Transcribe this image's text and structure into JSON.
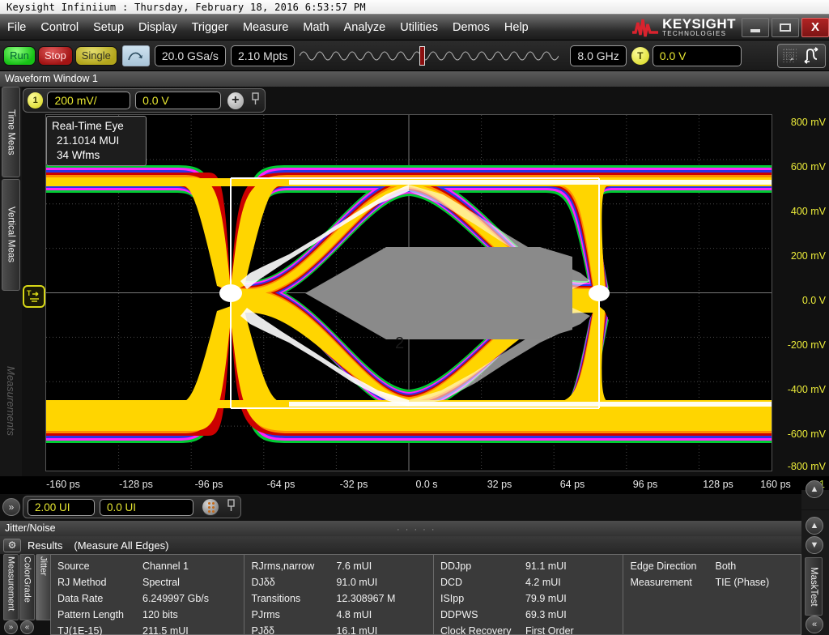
{
  "window": {
    "title": "Keysight Infiniium : Thursday, February 18, 2016 6:53:57 PM",
    "minimize_label": "minimize",
    "maximize_label": "maximize",
    "close_label": "X"
  },
  "brand": {
    "name": "KEYSIGHT",
    "subtitle": "TECHNOLOGIES"
  },
  "menu": {
    "items": [
      {
        "label": "File"
      },
      {
        "label": "Control"
      },
      {
        "label": "Setup"
      },
      {
        "label": "Display"
      },
      {
        "label": "Trigger"
      },
      {
        "label": "Measure"
      },
      {
        "label": "Math"
      },
      {
        "label": "Analyze"
      },
      {
        "label": "Utilities"
      },
      {
        "label": "Demos"
      },
      {
        "label": "Help"
      }
    ]
  },
  "toolbar": {
    "run_label": "Run",
    "stop_label": "Stop",
    "single_label": "Single",
    "autoscale_icon": "autoscale-icon",
    "sample_rate": "20.0 GSa/s",
    "memory_depth": "2.10 Mpts",
    "bandwidth": "8.0 GHz",
    "trigger_badge": "T",
    "trigger_level": "0.0 V",
    "nav_icon": "waveform-navigate-icon"
  },
  "waveform_window": {
    "title": "Waveform Window 1",
    "channel": {
      "number": "1",
      "scale": "200 mV/",
      "offset": "0.0 V",
      "add_label": "+",
      "pin_label": "pin-icon"
    }
  },
  "left_rail": {
    "tabs": [
      {
        "label": "Time Meas",
        "selected": true
      },
      {
        "label": "Vertical Meas",
        "selected": false
      },
      {
        "label": "Measurements",
        "selected": false,
        "dim": true
      }
    ]
  },
  "eye_legend": {
    "title": "Real-Time Eye",
    "mui": "21.1014 MUI",
    "waveforms": "34 Wfms"
  },
  "plot": {
    "trigger_icon": "trigger-level-icon",
    "mask_label": "2",
    "vertical_scale": "200 mV/",
    "y_ticks": [
      "800 mV",
      "600 mV",
      "400 mV",
      "200 mV",
      "0.0 V",
      "-200 mV",
      "-400 mV",
      "-600 mV",
      "-800 mV"
    ],
    "x_ticks": [
      "-160 ps",
      "-128 ps",
      "-96 ps",
      "-64 ps",
      "-32 ps",
      "0.0 s",
      "32 ps",
      "64 ps",
      "96 ps",
      "128 ps",
      "160 ps"
    ],
    "channel_marker": "1"
  },
  "ui_bar": {
    "expand_label": "»",
    "span": "2.00 UI",
    "position": "0.0 UI",
    "eye_icon": "eye-pattern-icon",
    "pin_label": "pin-icon"
  },
  "jitter_noise": {
    "title": "Jitter/Noise"
  },
  "results": {
    "gear_icon": "gear-icon",
    "title": "Results",
    "subtitle": "(Measure All Edges)",
    "tabs": [
      {
        "label": "Measurement"
      },
      {
        "label": "ColorGrade"
      },
      {
        "label": "Jitter",
        "selected": true
      }
    ],
    "columns": [
      {
        "rows": [
          {
            "key": "Source",
            "value": "Channel 1"
          },
          {
            "key": "RJ Method",
            "value": "Spectral"
          },
          {
            "key": "Data Rate",
            "value": "6.249997 Gb/s"
          },
          {
            "key": "Pattern Length",
            "value": "120 bits"
          },
          {
            "key": "TJ(1E-15)",
            "value": "211.5 mUI"
          }
        ]
      },
      {
        "rows": [
          {
            "key": "RJrms,narrow",
            "value": "7.6 mUI"
          },
          {
            "key": "DJδδ",
            "value": "91.0 mUI"
          },
          {
            "key": "Transitions",
            "value": "12.308967 M"
          },
          {
            "key": "PJrms",
            "value": "4.8 mUI"
          },
          {
            "key": "PJδδ",
            "value": "16.1 mUI"
          }
        ]
      },
      {
        "rows": [
          {
            "key": "DDJpp",
            "value": "91.1 mUI"
          },
          {
            "key": "DCD",
            "value": "4.2 mUI"
          },
          {
            "key": "ISIpp",
            "value": "79.9 mUI"
          },
          {
            "key": "DDPWS",
            "value": "69.3 mUI"
          },
          {
            "key": "Clock Recovery",
            "value": "First Order"
          }
        ]
      },
      {
        "rows": [
          {
            "key": "Edge Direction",
            "value": "Both"
          },
          {
            "key": "Measurement",
            "value": "TIE (Phase)"
          }
        ]
      }
    ]
  },
  "right_rail": {
    "scroll_up": "▲",
    "scroll_down": "▼",
    "mask_test_label": "MaskTest",
    "collapse": "«"
  },
  "colors": {
    "brand_red": "#d9232e",
    "graticule": "#3d3d3d",
    "yellow": "#ecec3a",
    "panel_bg": "#3a3a3a",
    "eye_density": [
      "#00cc33",
      "#ff00ff",
      "#2233ee",
      "#cc0000",
      "#ff8800",
      "#ffdd00",
      "#ffffff"
    ],
    "mask_gray": "#808080"
  }
}
